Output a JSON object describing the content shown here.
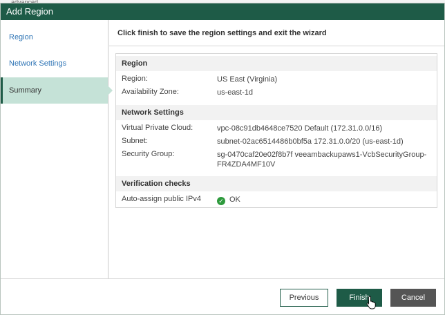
{
  "background": {
    "peek_text": "advanced"
  },
  "dialog": {
    "title": "Add Region",
    "header": "Click finish to save the region settings and exit the wizard"
  },
  "sidebar": {
    "items": [
      {
        "label": "Region",
        "active": false
      },
      {
        "label": "Network Settings",
        "active": false
      },
      {
        "label": "Summary",
        "active": true
      }
    ]
  },
  "summary": {
    "region": {
      "title": "Region",
      "rows": [
        {
          "label": "Region:",
          "value": "US East (Virginia)"
        },
        {
          "label": "Availability Zone:",
          "value": "us-east-1d"
        }
      ]
    },
    "network": {
      "title": "Network Settings",
      "rows": [
        {
          "label": "Virtual Private Cloud:",
          "value": "vpc-08c91db4648ce7520 Default (172.31.0.0/16)"
        },
        {
          "label": "Subnet:",
          "value": "subnet-02ac6514486b0bf5a 172.31.0.0/20 (us-east-1d)"
        },
        {
          "label": "Security Group:",
          "value": "sg-0470caf20e02f8b7f veeambackupaws1-VcbSecurityGroup-FR4ZDA4MF10V"
        }
      ]
    },
    "verification": {
      "title": "Verification checks",
      "rows": [
        {
          "label": "Auto-assign public IPv4",
          "value": "OK"
        }
      ]
    }
  },
  "footer": {
    "previous_label": "Previous",
    "finish_label": "Finish",
    "cancel_label": "Cancel"
  },
  "colors": {
    "titlebar": "#1e5b47",
    "active_nav": "#c5e2d7",
    "link": "#2e74b5",
    "ok": "#2e9a3d",
    "cancel": "#555555"
  },
  "icons": {
    "ok": "check-circle-icon",
    "cursor": "hand-pointer-icon"
  }
}
